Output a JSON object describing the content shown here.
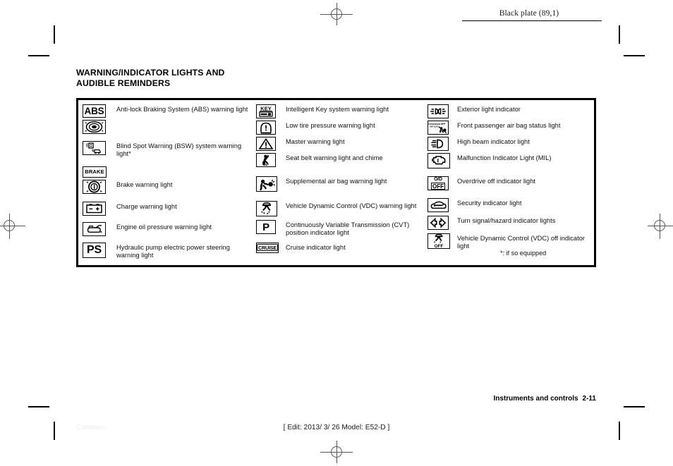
{
  "page": {
    "black_plate": "Black plate (89,1)",
    "section_title_line1": "WARNING/INDICATOR LIGHTS AND",
    "section_title_line2": "AUDIBLE REMINDERS",
    "footnote": "*: if so equipped",
    "footer_chapter": "Instruments and controls",
    "footer_page": "2-11",
    "edit_line": "[ Edit: 2013/ 3/ 26   Model: E52-D ]",
    "condition": "Condition:"
  },
  "colors": {
    "ink": "#000000",
    "paper": "#ffffff",
    "body_text": "#111111",
    "faint": "#ececec"
  },
  "columns": [
    {
      "rows": [
        {
          "icons": [
            "abs-warning-icon",
            "abs-wheel-icon"
          ],
          "icon_text": [
            "ABS",
            ""
          ],
          "label": "Anti-lock Braking System (ABS) warning light"
        },
        {
          "icons": [
            "blind-spot-warning-icon"
          ],
          "icon_text": [
            ""
          ],
          "label": "Blind Spot Warning (BSW) system warning light*"
        },
        {
          "icons": [
            "brake-text-icon",
            "brake-circle-icon"
          ],
          "icon_text": [
            "BRAKE",
            ""
          ],
          "label": "Brake warning light"
        },
        {
          "icons": [
            "battery-charge-icon"
          ],
          "icon_text": [
            ""
          ],
          "label": "Charge warning light"
        },
        {
          "icons": [
            "oil-pressure-icon"
          ],
          "icon_text": [
            ""
          ],
          "label": "Engine oil pressure warning light"
        },
        {
          "icons": [
            "power-steering-icon"
          ],
          "icon_text": [
            "PS"
          ],
          "label": "Hydraulic pump electric power steering warning light"
        }
      ]
    },
    {
      "rows": [
        {
          "icons": [
            "intelligent-key-icon"
          ],
          "icon_text": [
            "KEY"
          ],
          "label": "Intelligent Key system warning light"
        },
        {
          "icons": [
            "low-tire-pressure-icon"
          ],
          "icon_text": [
            ""
          ],
          "label": "Low tire pressure warning light"
        },
        {
          "icons": [
            "master-warning-icon"
          ],
          "icon_text": [
            ""
          ],
          "label": "Master warning light"
        },
        {
          "icons": [
            "seat-belt-warning-icon"
          ],
          "icon_text": [
            ""
          ],
          "label": "Seat belt warning light and chime"
        },
        {
          "icons": [
            "supplemental-air-bag-icon"
          ],
          "icon_text": [
            ""
          ],
          "label": "Supplemental air bag warning light"
        },
        {
          "icons": [
            "vdc-warning-icon"
          ],
          "icon_text": [
            ""
          ],
          "label": "Vehicle Dynamic Control (VDC) warning light"
        },
        {
          "icons": [
            "cvt-position-icon"
          ],
          "icon_text": [
            "P"
          ],
          "label": "Continuously Variable Transmission (CVT) position indicator light"
        },
        {
          "icons": [
            "cruise-indicator-icon"
          ],
          "icon_text": [
            "CRUISE"
          ],
          "label": "Cruise indicator light"
        }
      ]
    },
    {
      "rows": [
        {
          "icons": [
            "exterior-light-icon"
          ],
          "icon_text": [
            ""
          ],
          "label": "Exterior light indicator"
        },
        {
          "icons": [
            "passenger-air-bag-off-icon"
          ],
          "icon_text": [
            "PASSENGER AIR BAG",
            "OFF"
          ],
          "label": "Front passenger air bag status light"
        },
        {
          "icons": [
            "high-beam-icon"
          ],
          "icon_text": [
            ""
          ],
          "label": "High beam indicator light"
        },
        {
          "icons": [
            "malfunction-indicator-icon"
          ],
          "icon_text": [
            ""
          ],
          "label": "Malfunction Indicator Light (MIL)"
        },
        {
          "icons": [
            "overdrive-off-icon"
          ],
          "icon_text": [
            "O/D",
            "OFF"
          ],
          "label": "Overdrive off indicator light"
        },
        {
          "icons": [
            "security-indicator-icon"
          ],
          "icon_text": [
            ""
          ],
          "label": "Security indicator light"
        },
        {
          "icons": [
            "turn-signal-hazard-icon"
          ],
          "icon_text": [
            ""
          ],
          "label": "Turn signal/hazard indicator lights"
        },
        {
          "icons": [
            "vdc-off-icon"
          ],
          "icon_text": [
            "OFF"
          ],
          "label": "Vehicle Dynamic Control (VDC) off indicator light"
        }
      ]
    }
  ]
}
